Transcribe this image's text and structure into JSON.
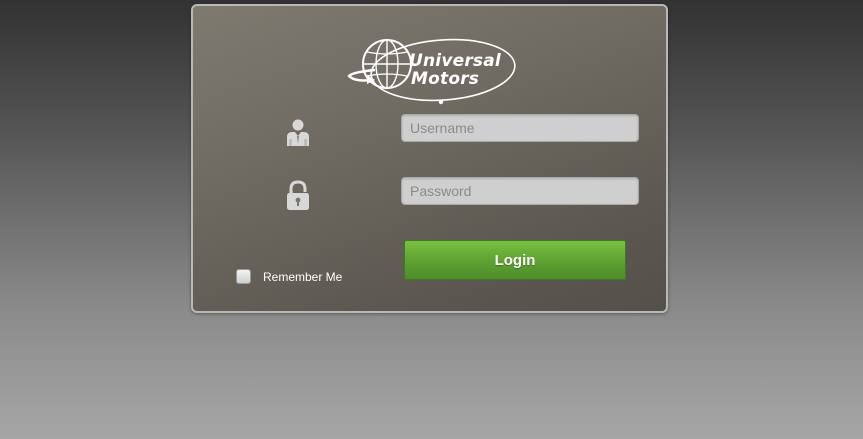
{
  "logo": {
    "line1": "Universal",
    "line2": "Motors"
  },
  "form": {
    "username_placeholder": "Username",
    "password_placeholder": "Password",
    "login_label": "Login",
    "remember_label": "Remember Me",
    "remember_checked": false
  },
  "icons": {
    "logo": "globe-icon",
    "username": "user-icon",
    "password": "lock-icon"
  },
  "colors": {
    "panel_background": "#6e6a62",
    "login_button": "#5fa332",
    "field_background": "#cfcfcf"
  }
}
